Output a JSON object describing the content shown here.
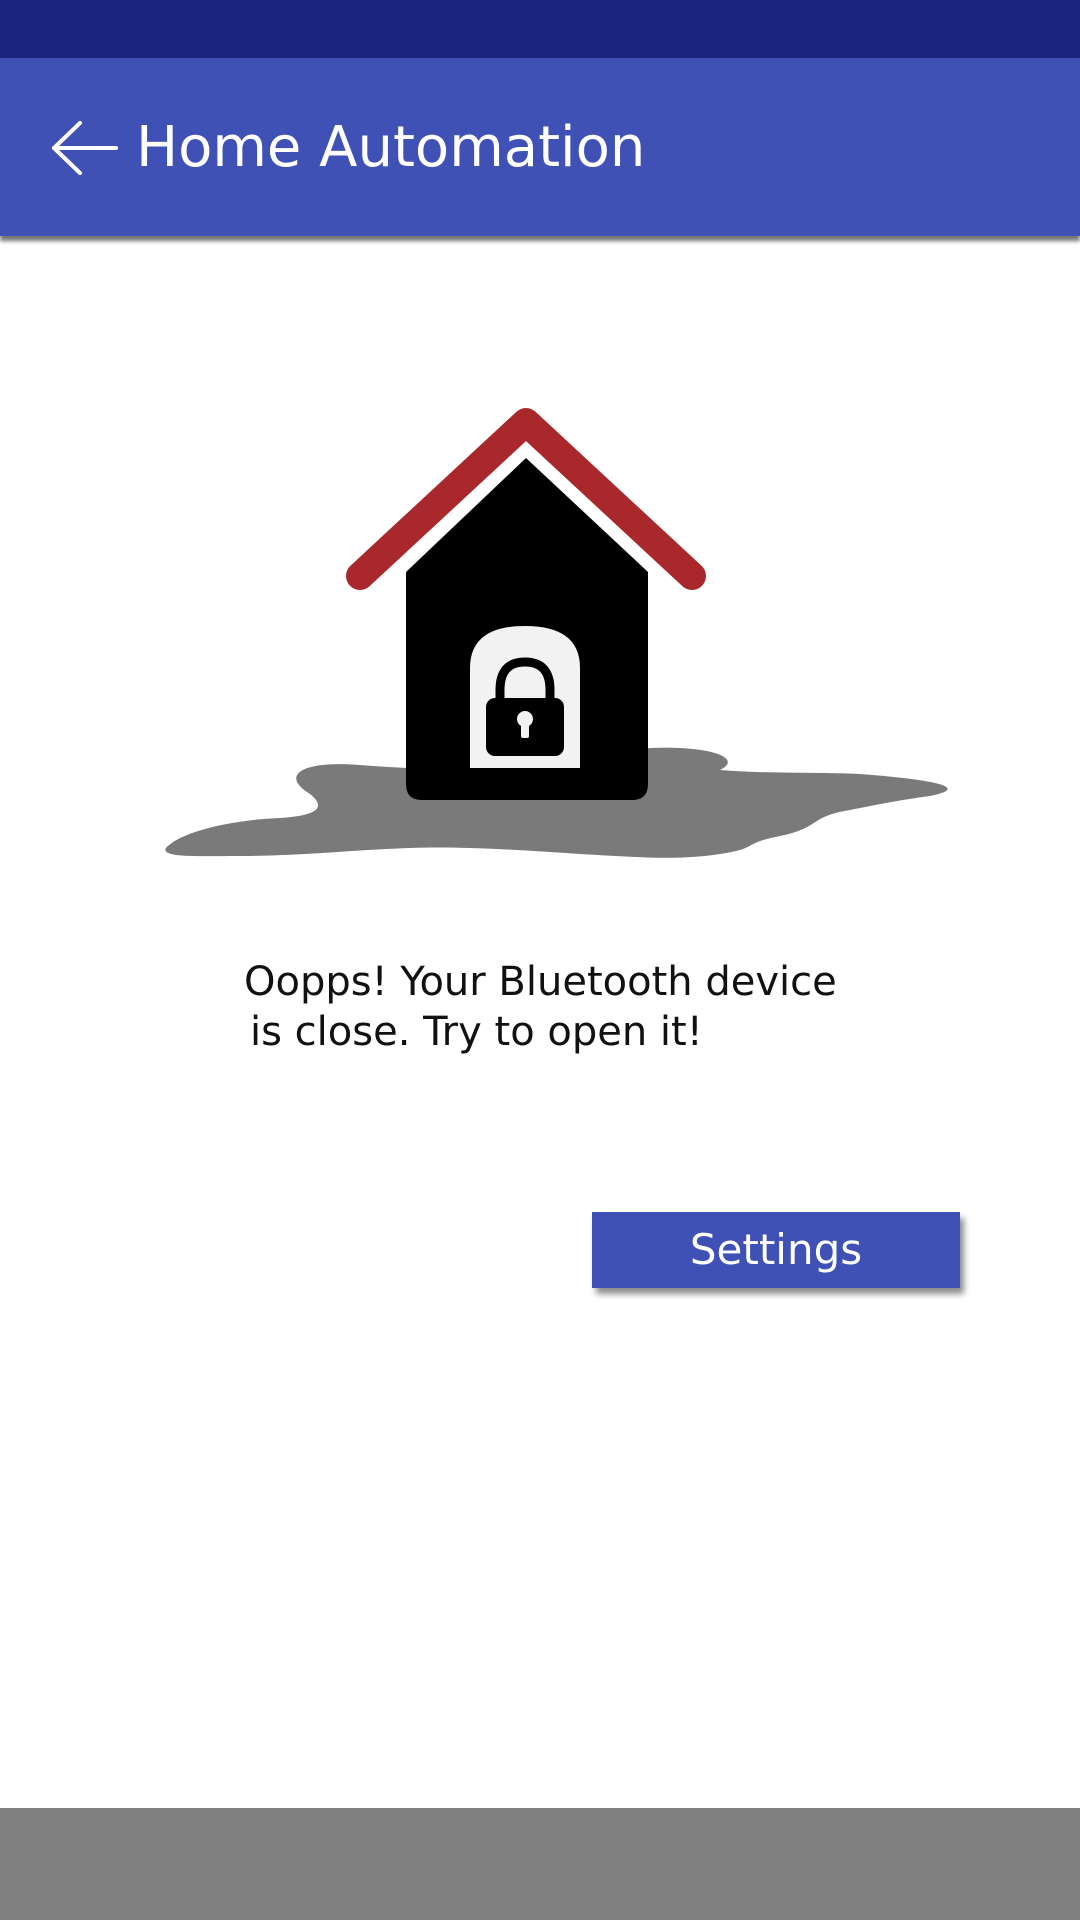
{
  "app_bar": {
    "title": "Home Automation",
    "back_icon": "arrow-back-icon",
    "color": "#3f51b5"
  },
  "status_bar": {
    "color": "#1a237e"
  },
  "illustration": {
    "icon": "locked-house-icon",
    "roof_color": "#a9282c",
    "house_color": "#000000",
    "shadow_color": "#7a7a7a"
  },
  "message": {
    "line1": "Oopps! Your Bluetooth device",
    "line2": "is close. Try to open it!"
  },
  "actions": {
    "settings_label": "Settings"
  },
  "nav_bar": {
    "color": "#808080"
  }
}
